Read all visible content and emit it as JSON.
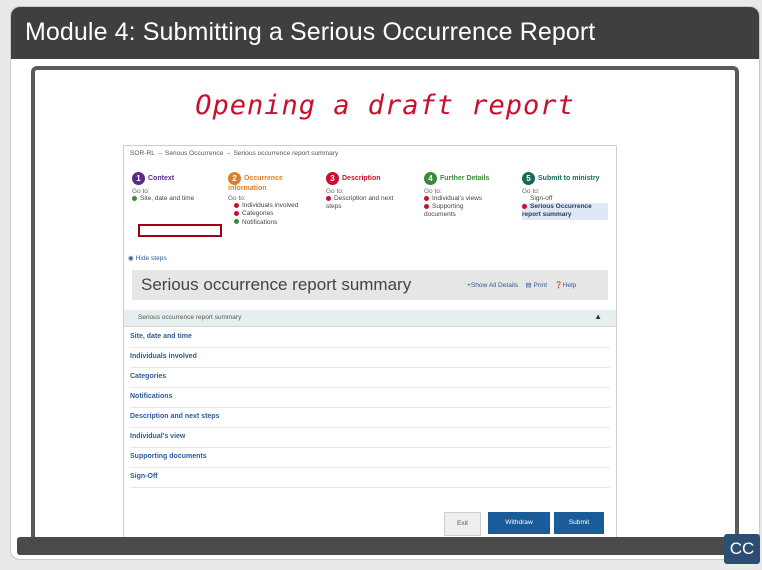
{
  "banner": {
    "title": "Module 4:  Submitting a Serious Occurrence Report"
  },
  "slide": {
    "heading": "Opening a draft report"
  },
  "app": {
    "breadcrumb": "SOR-RL  →  Serious Occurrence  →  Serious occurrence report summary",
    "steps": [
      {
        "num": "1",
        "title": "Context",
        "color": "#5b2a86",
        "goto": "Go to:",
        "items": [
          {
            "label": "Site, date and time",
            "status": "complete"
          }
        ]
      },
      {
        "num": "2",
        "title": "Occurrence information",
        "color": "#d9822b",
        "goto": "Go to:",
        "items": [
          {
            "label": "Individuals involved",
            "status": "incomplete"
          },
          {
            "label": "Categories",
            "status": "incomplete"
          },
          {
            "label": "Notifications",
            "status": "complete"
          }
        ]
      },
      {
        "num": "3",
        "title": "Description",
        "color": "#c8102e",
        "goto": "Go to:",
        "items": [
          {
            "label": "Description and next steps",
            "status": "incomplete"
          }
        ]
      },
      {
        "num": "4",
        "title": "Further Details",
        "color": "#3a8a3a",
        "goto": "Go to:",
        "items": [
          {
            "label": "Individual's views",
            "status": "incomplete"
          },
          {
            "label": "Supporting documents",
            "status": "incomplete"
          }
        ]
      },
      {
        "num": "5",
        "title": "Submit to ministry",
        "color": "#1a6a5a",
        "goto": "Go to:",
        "items": [
          {
            "label": "Sign-off",
            "status": "none"
          },
          {
            "label": "Serious Occurrence report summary",
            "status": "current"
          }
        ]
      }
    ],
    "hide_steps": "Hide steps",
    "page_title": "Serious occurrence report summary",
    "actions": {
      "show_all": "Show All Details",
      "print": "Print",
      "help": "Help"
    },
    "accordion_label": "Serious occurrence report summary",
    "sections": [
      "Site, date and time",
      "Individuals involved",
      "Categories",
      "Notifications",
      "Description and next steps",
      "Individual's view",
      "Supporting documents",
      "Sign-Off"
    ],
    "buttons": {
      "exit": "Exit",
      "withdraw": "Withdraw",
      "submit": "Submit"
    }
  },
  "player": {
    "cc": "CC"
  },
  "colors": {
    "accent": "#1a5b9a",
    "banner": "#3f3f3f",
    "highlight": "#a00014",
    "heading": "#c8102e"
  }
}
